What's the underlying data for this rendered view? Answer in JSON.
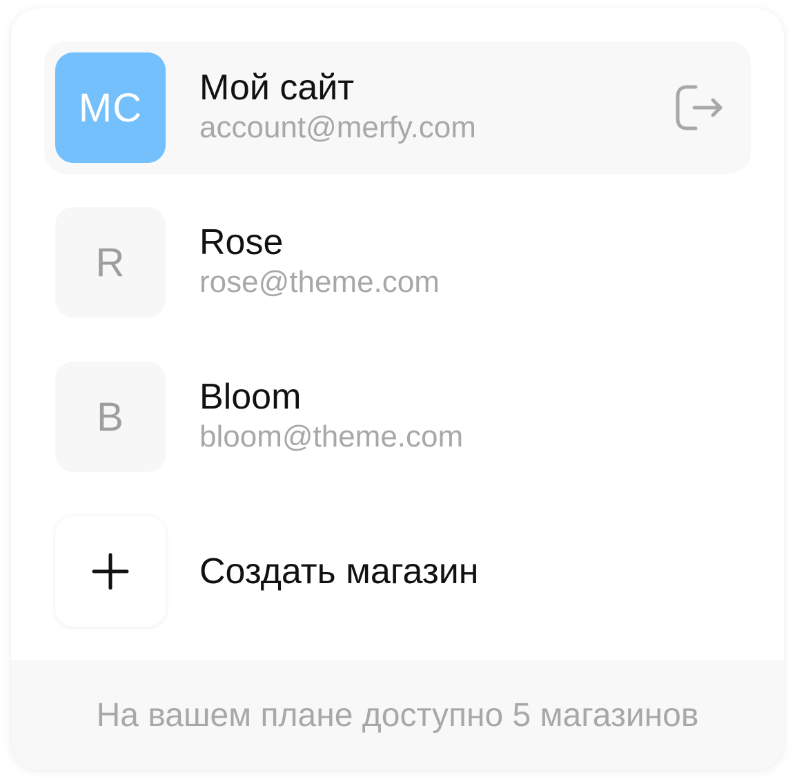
{
  "stores": [
    {
      "initials": "МС",
      "name": "Мой сайт",
      "email": "account@merfy.com",
      "active": true
    },
    {
      "initials": "R",
      "name": "Rose",
      "email": "rose@theme.com",
      "active": false
    },
    {
      "initials": "B",
      "name": "Bloom",
      "email": "bloom@theme.com",
      "active": false
    }
  ],
  "create": {
    "icon": "plus-icon",
    "label": "Создать магазин"
  },
  "logout": {
    "icon": "logout-icon"
  },
  "footer": {
    "text": "На вашем плане доступно 5 магазинов"
  },
  "colors": {
    "accent": "#74c0fc",
    "text": "#111111",
    "muted": "#a8a8a8",
    "row_bg": "#f8f8f8"
  }
}
